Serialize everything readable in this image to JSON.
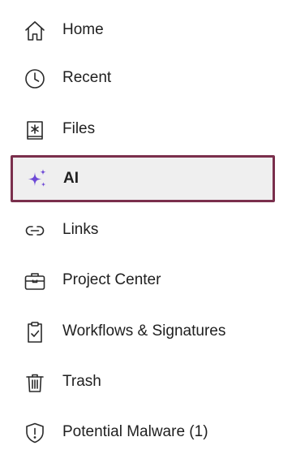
{
  "sidebar": {
    "active_border_color": "#7a2f4c",
    "ai_icon_color": "#6e4ad6",
    "items": [
      {
        "label": "Home",
        "icon": "home-icon"
      },
      {
        "label": "Recent",
        "icon": "clock-icon"
      },
      {
        "label": "Files",
        "icon": "files-icon"
      },
      {
        "label": "AI",
        "icon": "sparkles-icon",
        "active": true
      },
      {
        "label": "Links",
        "icon": "link-icon"
      },
      {
        "label": "Project Center",
        "icon": "briefcase-icon"
      },
      {
        "label": "Workflows & Signatures",
        "icon": "clipboard-check-icon"
      },
      {
        "label": "Trash",
        "icon": "trash-icon"
      },
      {
        "label": "Potential Malware (1)",
        "icon": "shield-alert-icon"
      }
    ]
  }
}
